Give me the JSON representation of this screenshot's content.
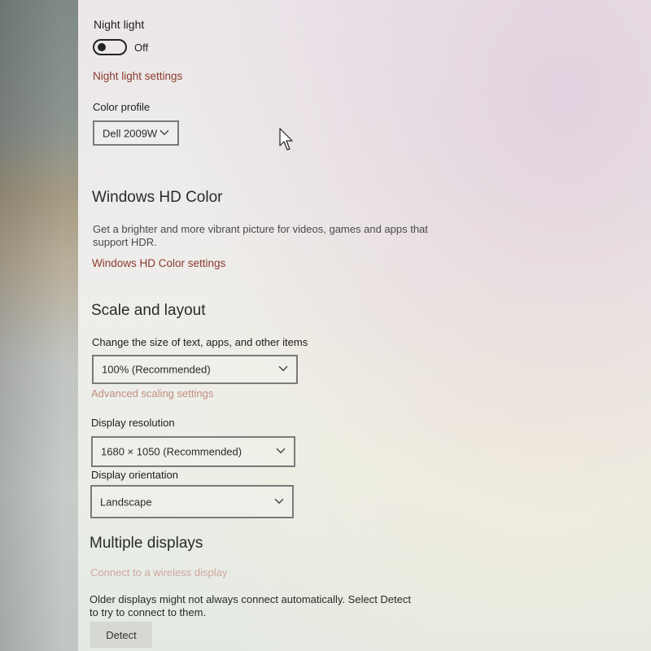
{
  "night_light": {
    "label": "Night light",
    "toggle_state": "Off",
    "settings_link": "Night light settings"
  },
  "color_profile": {
    "label": "Color profile",
    "value": "Dell 2009W"
  },
  "hd_color": {
    "heading": "Windows HD Color",
    "description": "Get a brighter and more vibrant picture for videos, games and apps that support HDR.",
    "settings_link": "Windows HD Color settings"
  },
  "scale_layout": {
    "heading": "Scale and layout",
    "scale_label": "Change the size of text, apps, and other items",
    "scale_value": "100% (Recommended)",
    "advanced_link": "Advanced scaling settings",
    "resolution_label": "Display resolution",
    "resolution_value": "1680 × 1050 (Recommended)",
    "orientation_label": "Display orientation",
    "orientation_value": "Landscape"
  },
  "multiple_displays": {
    "heading": "Multiple displays",
    "wireless_link": "Connect to a wireless display",
    "description": "Older displays might not always connect automatically. Select Detect to try to connect to them.",
    "detect_button": "Detect"
  },
  "icons": {
    "dropdown": "chevron-down-icon",
    "cursor": "mouse-pointer-icon"
  },
  "colors": {
    "link": "#8b3a2b",
    "text": "#222222"
  }
}
